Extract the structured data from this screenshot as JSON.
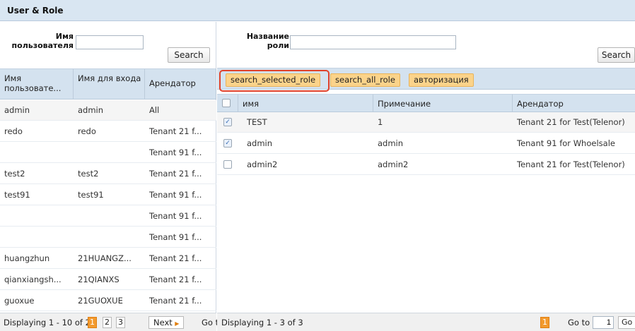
{
  "window": {
    "title": "User & Role"
  },
  "users_panel": {
    "filter_label": "Имя пользователя",
    "filter_value": "",
    "search_label": "Search",
    "columns": [
      "Имя пользовате...",
      "Имя для входа",
      "Арендатор"
    ],
    "rows": [
      [
        "admin",
        "admin",
        "All"
      ],
      [
        "redo",
        "redo",
        "Tenant 21 f..."
      ],
      [
        "",
        "",
        "Tenant 91 f..."
      ],
      [
        "test2",
        "test2",
        "Tenant 21 f..."
      ],
      [
        "test91",
        "test91",
        "Tenant 91 f..."
      ],
      [
        "",
        "",
        "Tenant 91 f..."
      ],
      [
        "",
        "",
        "Tenant 91 f..."
      ],
      [
        "huangzhun",
        "21HUANGZ...",
        "Tenant 21 f..."
      ],
      [
        "qianxiangsh...",
        "21QIANXS",
        "Tenant 21 f..."
      ],
      [
        "guoxue",
        "21GUOXUE",
        "Tenant 21 f..."
      ]
    ],
    "pager": {
      "display_text": "Displaying 1 - 10 of 2",
      "pages": [
        "1",
        "2",
        "3"
      ],
      "active_page": "1",
      "next_label": "Next",
      "goto_label": "Go t"
    }
  },
  "roles_panel": {
    "filter_label": "Название роли",
    "filter_value": "",
    "search_label": "Search",
    "toolbar": {
      "search_selected": "search_selected_role",
      "search_all": "search_all_role",
      "authorize": "авторизация"
    },
    "columns": [
      "имя",
      "Примечание",
      "Арендатор"
    ],
    "rows": [
      {
        "checked": true,
        "cells": [
          "TEST",
          "1",
          "Tenant 21 for Test(Telenor)"
        ]
      },
      {
        "checked": true,
        "cells": [
          "admin",
          "admin",
          "Tenant 91 for Whoelsale"
        ]
      },
      {
        "checked": false,
        "cells": [
          "admin2",
          "admin2",
          "Tenant 21 for Test(Telenor)"
        ]
      }
    ],
    "pager": {
      "display_text": "Displaying 1 - 3 of 3",
      "active_page": "1",
      "goto_label": "Go to",
      "goto_value": "1",
      "go_label": "Go"
    }
  },
  "colors": {
    "header_bg": "#d9e6f2",
    "toolbar_button": "#fbd38a",
    "highlight_border": "#e0422b",
    "active_page": "#f29a2e"
  },
  "icons": {
    "checkbox": "checkbox-icon",
    "next_arrow": "triangle-right-icon"
  }
}
